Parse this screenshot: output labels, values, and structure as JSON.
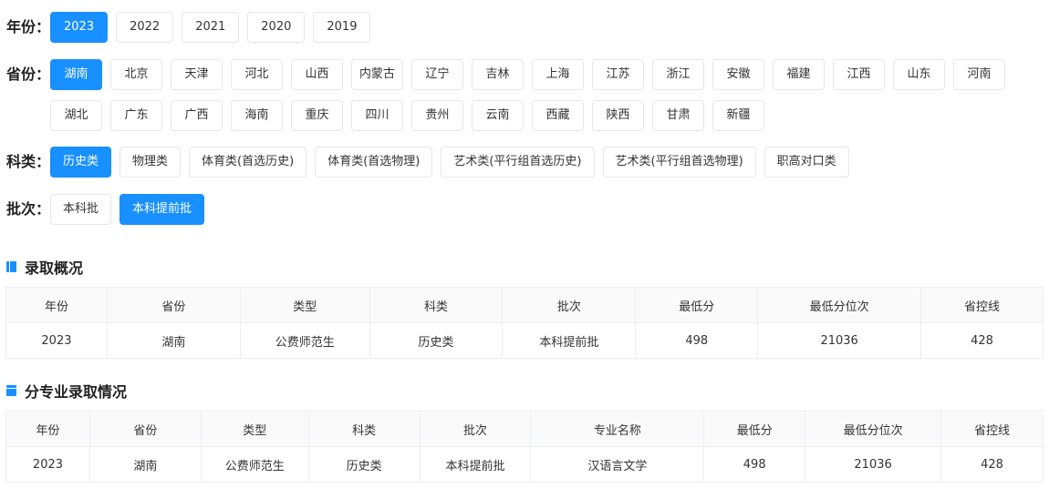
{
  "filters": {
    "year": {
      "label": "年份：",
      "options": [
        "2023",
        "2022",
        "2021",
        "2020",
        "2019"
      ],
      "active": 0
    },
    "province": {
      "label": "省份：",
      "options": [
        "湖南",
        "北京",
        "天津",
        "河北",
        "山西",
        "内蒙古",
        "辽宁",
        "吉林",
        "上海",
        "江苏",
        "浙江",
        "安徽",
        "福建",
        "江西",
        "山东",
        "河南",
        "湖北",
        "广东",
        "广西",
        "海南",
        "重庆",
        "四川",
        "贵州",
        "云南",
        "西藏",
        "陕西",
        "甘肃",
        "新疆"
      ],
      "active": 0
    },
    "subject": {
      "label": "科类：",
      "options": [
        "历史类",
        "物理类",
        "体育类(首选历史)",
        "体育类(首选物理)",
        "艺术类(平行组首选历史)",
        "艺术类(平行组首选物理)",
        "职高对口类"
      ],
      "active": 0
    },
    "batch": {
      "label": "批次：",
      "options": [
        "本科批",
        "本科提前批"
      ],
      "active": 1
    }
  },
  "admission": {
    "title": "录取概况",
    "headers": [
      "年份",
      "省份",
      "类型",
      "科类",
      "批次",
      "最低分",
      "最低分位次",
      "省控线"
    ],
    "rows": [
      [
        "2023",
        "湖南",
        "公费师范生",
        "历史类",
        "本科提前批",
        "498",
        "21036",
        "428"
      ]
    ]
  },
  "major": {
    "title": "分专业录取情况",
    "headers": [
      "年份",
      "省份",
      "类型",
      "科类",
      "批次",
      "专业名称",
      "最低分",
      "最低分位次",
      "省控线"
    ],
    "rows": [
      [
        "2023",
        "湖南",
        "公费师范生",
        "历史类",
        "本科提前批",
        "汉语言文学",
        "498",
        "21036",
        "428"
      ]
    ]
  },
  "colors": {
    "accent": "#1890ff",
    "border": "#ebeef5",
    "header_bg": "#fafafa"
  },
  "icons": {
    "admission": "book-icon",
    "major": "calendar-icon"
  }
}
